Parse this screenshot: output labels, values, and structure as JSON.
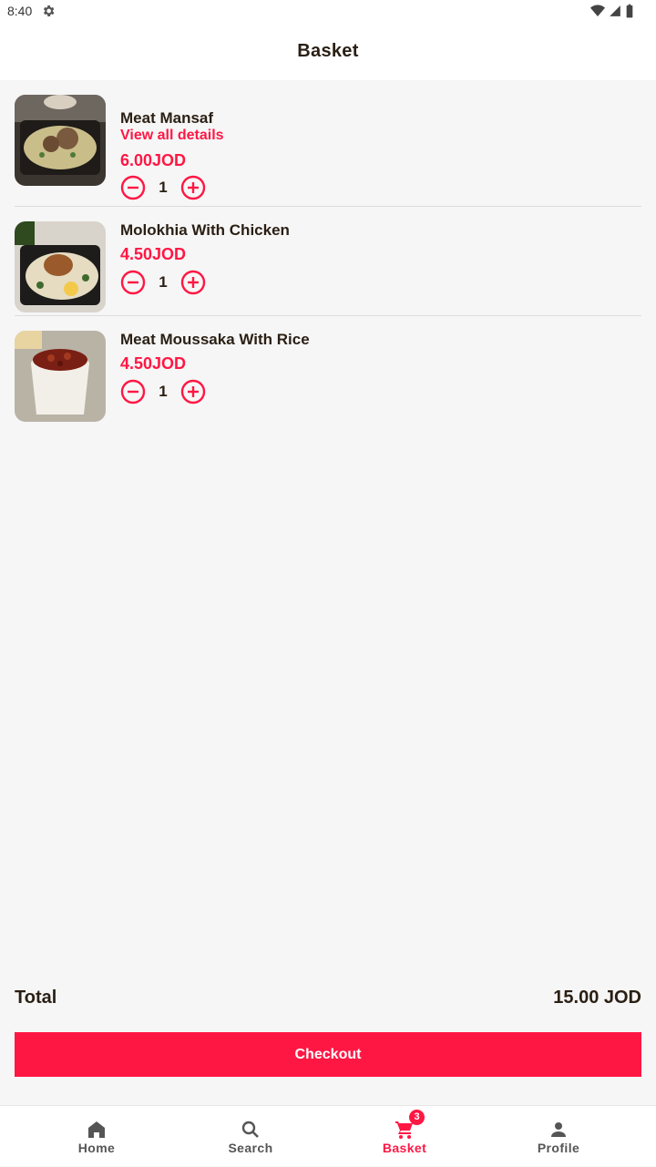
{
  "status_bar": {
    "time": "8:40"
  },
  "header": {
    "title": "Basket"
  },
  "items": [
    {
      "name": "Meat Mansaf",
      "details_link": "View all details",
      "price": "6.00JOD",
      "quantity": "1"
    },
    {
      "name": "Molokhia With Chicken",
      "price": "4.50JOD",
      "quantity": "1"
    },
    {
      "name": "Meat Moussaka With Rice",
      "price": "4.50JOD",
      "quantity": "1"
    }
  ],
  "summary": {
    "total_label": "Total",
    "total_value": "15.00 JOD"
  },
  "checkout": {
    "label": "Checkout"
  },
  "nav": {
    "items": [
      {
        "label": "Home",
        "icon": "home-icon"
      },
      {
        "label": "Search",
        "icon": "search-icon"
      },
      {
        "label": "Basket",
        "icon": "cart-icon",
        "badge": "3",
        "active": true
      },
      {
        "label": "Profile",
        "icon": "person-icon"
      }
    ]
  },
  "colors": {
    "accent": "#ff1744",
    "text": "#2a1f14",
    "background": "#f6f6f6"
  }
}
